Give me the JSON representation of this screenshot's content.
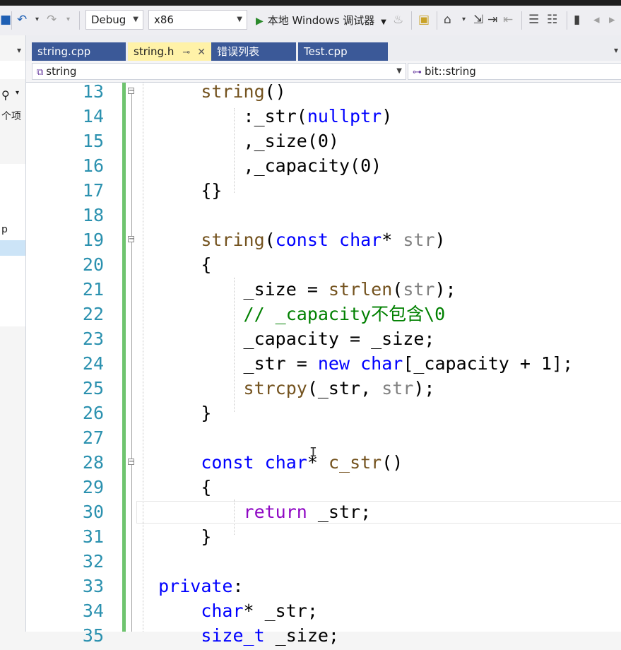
{
  "toolbar": {
    "config": "Debug",
    "platform": "x86",
    "debugger_label": "本地 Windows 调试器"
  },
  "side": {
    "text_a": "个项",
    "text_b": "p"
  },
  "tabs": [
    {
      "label": "string.cpp",
      "active": false
    },
    {
      "label": "string.h",
      "active": true
    },
    {
      "label": "错误列表",
      "active": false
    },
    {
      "label": "Test.cpp",
      "active": false
    }
  ],
  "nav": {
    "scope": "string",
    "member": "bit::string"
  },
  "code_lines": [
    {
      "n": "13",
      "fold": true,
      "indent": "    ",
      "tokens": [
        [
          "f",
          "string"
        ],
        [
          "n",
          "()"
        ]
      ]
    },
    {
      "n": "14",
      "fold": false,
      "indent": "        ",
      "tokens": [
        [
          "n",
          ":_str("
        ],
        [
          "k",
          "nullptr"
        ],
        [
          "n",
          ")"
        ]
      ]
    },
    {
      "n": "15",
      "fold": false,
      "indent": "        ",
      "tokens": [
        [
          "n",
          ",_size(0)"
        ]
      ]
    },
    {
      "n": "16",
      "fold": false,
      "indent": "        ",
      "tokens": [
        [
          "n",
          ",_capacity(0)"
        ]
      ]
    },
    {
      "n": "17",
      "fold": false,
      "indent": "    ",
      "tokens": [
        [
          "n",
          "{}"
        ]
      ]
    },
    {
      "n": "18",
      "fold": false,
      "indent": "",
      "tokens": []
    },
    {
      "n": "19",
      "fold": true,
      "indent": "    ",
      "tokens": [
        [
          "f",
          "string"
        ],
        [
          "n",
          "("
        ],
        [
          "k",
          "const"
        ],
        [
          "n",
          " "
        ],
        [
          "k",
          "char"
        ],
        [
          "n",
          "* "
        ],
        [
          "p",
          "str"
        ],
        [
          "n",
          ")"
        ]
      ]
    },
    {
      "n": "20",
      "fold": false,
      "indent": "    ",
      "tokens": [
        [
          "n",
          "{"
        ]
      ]
    },
    {
      "n": "21",
      "fold": false,
      "indent": "        ",
      "tokens": [
        [
          "n",
          "_size = "
        ],
        [
          "f",
          "strlen"
        ],
        [
          "n",
          "("
        ],
        [
          "p",
          "str"
        ],
        [
          "n",
          ");"
        ]
      ]
    },
    {
      "n": "22",
      "fold": false,
      "indent": "        ",
      "tokens": [
        [
          "c",
          "// _capacity不包含\\0"
        ]
      ]
    },
    {
      "n": "23",
      "fold": false,
      "indent": "        ",
      "tokens": [
        [
          "n",
          "_capacity = _size;"
        ]
      ]
    },
    {
      "n": "24",
      "fold": false,
      "indent": "        ",
      "tokens": [
        [
          "n",
          "_str = "
        ],
        [
          "k",
          "new"
        ],
        [
          "n",
          " "
        ],
        [
          "k",
          "char"
        ],
        [
          "n",
          "[_capacity + 1];"
        ]
      ]
    },
    {
      "n": "25",
      "fold": false,
      "indent": "        ",
      "tokens": [
        [
          "f",
          "strcpy"
        ],
        [
          "n",
          "(_str, "
        ],
        [
          "p",
          "str"
        ],
        [
          "n",
          ");"
        ]
      ]
    },
    {
      "n": "26",
      "fold": false,
      "indent": "    ",
      "tokens": [
        [
          "n",
          "}"
        ]
      ]
    },
    {
      "n": "27",
      "fold": false,
      "indent": "",
      "tokens": []
    },
    {
      "n": "28",
      "fold": true,
      "indent": "    ",
      "tokens": [
        [
          "k",
          "const"
        ],
        [
          "n",
          " "
        ],
        [
          "k",
          "char"
        ],
        [
          "n",
          "* "
        ],
        [
          "f",
          "c_str"
        ],
        [
          "n",
          "()"
        ]
      ]
    },
    {
      "n": "29",
      "fold": false,
      "indent": "    ",
      "tokens": [
        [
          "n",
          "{"
        ]
      ]
    },
    {
      "n": "30",
      "fold": false,
      "indent": "        ",
      "tokens": [
        [
          "m",
          "return"
        ],
        [
          "n",
          " _str;"
        ]
      ]
    },
    {
      "n": "31",
      "fold": false,
      "indent": "    ",
      "tokens": [
        [
          "n",
          "}"
        ]
      ]
    },
    {
      "n": "32",
      "fold": false,
      "indent": "",
      "tokens": []
    },
    {
      "n": "33",
      "fold": false,
      "indent": "",
      "tokens": [
        [
          "k",
          "private"
        ],
        [
          "n",
          ":"
        ]
      ]
    },
    {
      "n": "34",
      "fold": false,
      "indent": "    ",
      "tokens": [
        [
          "k",
          "char"
        ],
        [
          "n",
          "* _str;"
        ]
      ]
    },
    {
      "n": "35",
      "fold": false,
      "indent": "    ",
      "tokens": [
        [
          "k",
          "size_t"
        ],
        [
          "n",
          " _size;"
        ]
      ]
    }
  ],
  "colors": {
    "keyword": "#0000ff",
    "function": "#74531f",
    "param": "#808080",
    "comment": "#008000",
    "control": "#8f08c4",
    "line_number": "#2b91af",
    "change_bar": "#6fc46f"
  }
}
